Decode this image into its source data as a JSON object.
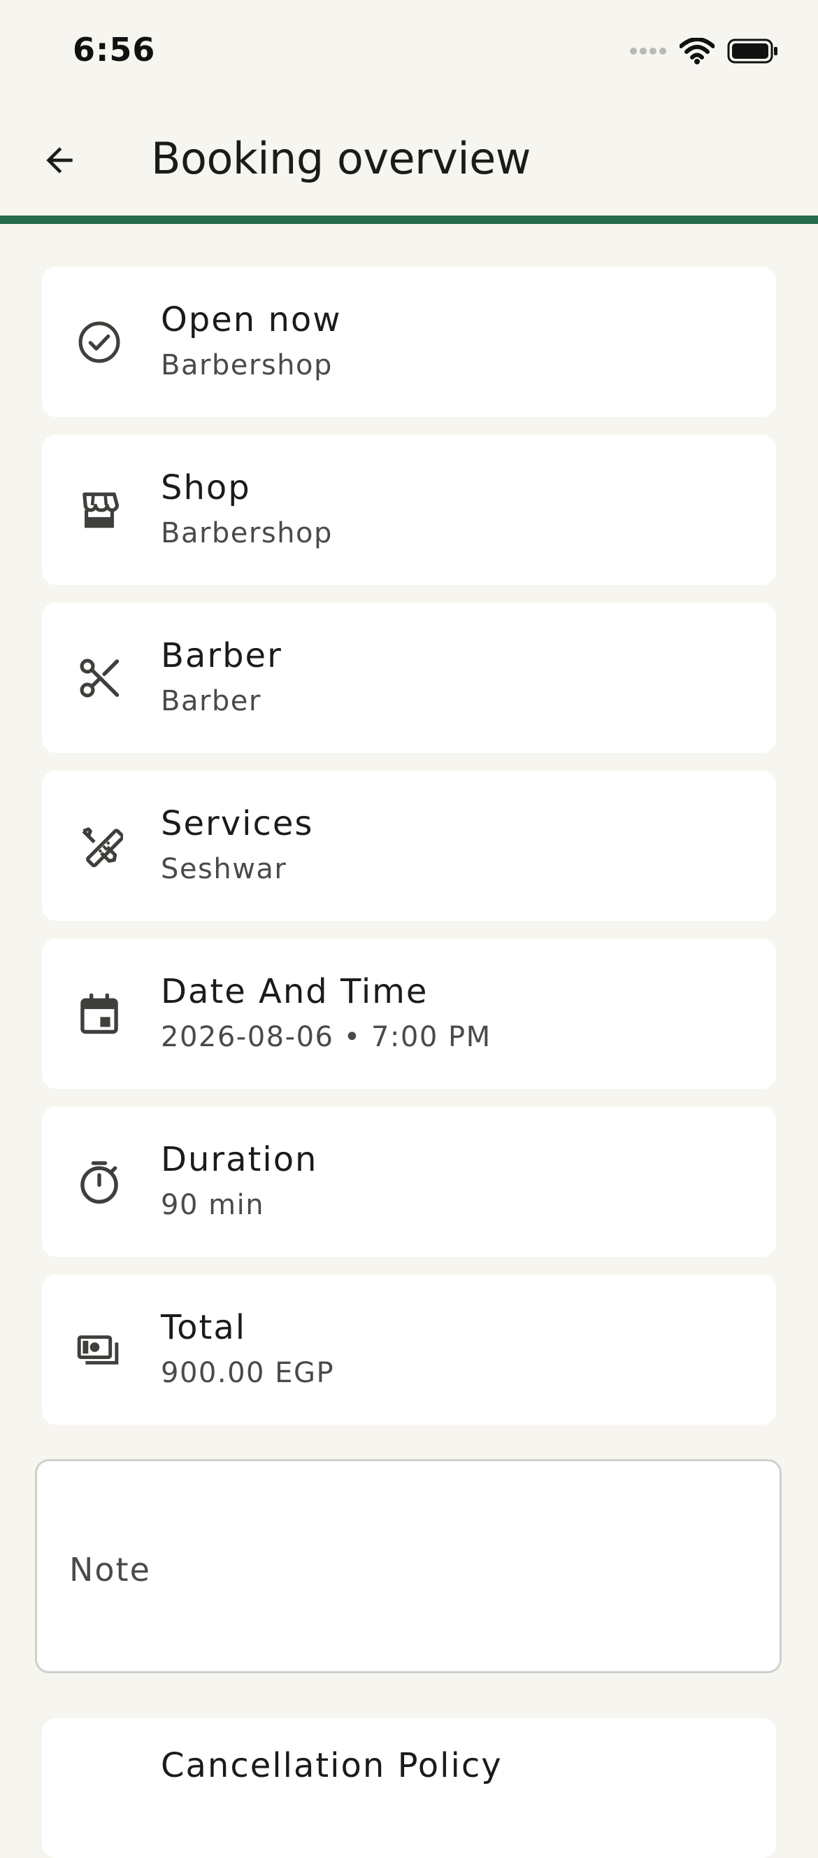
{
  "status_bar": {
    "time": "6:56"
  },
  "app_bar": {
    "title": "Booking overview"
  },
  "colors": {
    "accent": "#256a4d",
    "background": "#f7f5ef",
    "card": "#ffffff"
  },
  "cards": [
    {
      "icon": "check-circle-icon",
      "title": "Open now",
      "subtitle": "Barbershop"
    },
    {
      "icon": "storefront-icon",
      "title": "Shop",
      "subtitle": "Barbershop"
    },
    {
      "icon": "scissors-icon",
      "title": "Barber",
      "subtitle": "Barber"
    },
    {
      "icon": "tools-icon",
      "title": "Services",
      "subtitle": "Seshwar"
    },
    {
      "icon": "calendar-icon",
      "title": "Date And Time",
      "subtitle": "2026-08-06 • 7:00 PM"
    },
    {
      "icon": "timer-icon",
      "title": "Duration",
      "subtitle": "90 min"
    },
    {
      "icon": "payments-icon",
      "title": "Total",
      "subtitle": "900.00 EGP"
    }
  ],
  "note": {
    "label": "Note"
  },
  "cancellation": {
    "title": "Cancellation Policy"
  }
}
